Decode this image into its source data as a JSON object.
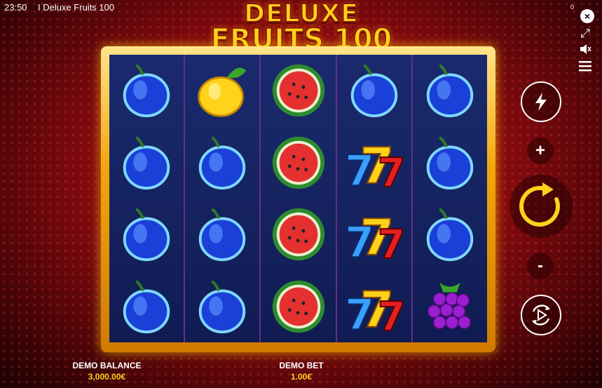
{
  "status_bar": {
    "time": "23:50",
    "title": "I Deluxe Fruits 100",
    "counter": "0"
  },
  "logo": {
    "line1": "DELUXE",
    "line2": "FRUITS 100"
  },
  "reels": [
    [
      "plum",
      "plum",
      "plum",
      "plum"
    ],
    [
      "lemon",
      "plum",
      "plum",
      "plum"
    ],
    [
      "watermelon",
      "watermelon",
      "watermelon",
      "watermelon"
    ],
    [
      "plum",
      "seven",
      "seven",
      "seven"
    ],
    [
      "plum",
      "plum",
      "plum",
      "grapes"
    ]
  ],
  "controls": {
    "turbo_icon": "lightning-icon",
    "plus": "+",
    "minus": "-",
    "spin_icon": "spin-arrow-icon",
    "autoplay_icon": "autoplay-icon"
  },
  "balance": {
    "label": "DEMO BALANCE",
    "value": "3,000.00€"
  },
  "bet": {
    "label": "DEMO BET",
    "value": "1.00€"
  },
  "colors": {
    "accent": "#ffd21c",
    "frame": "#f2a60c",
    "reel_bg": "#1a2a6e"
  }
}
